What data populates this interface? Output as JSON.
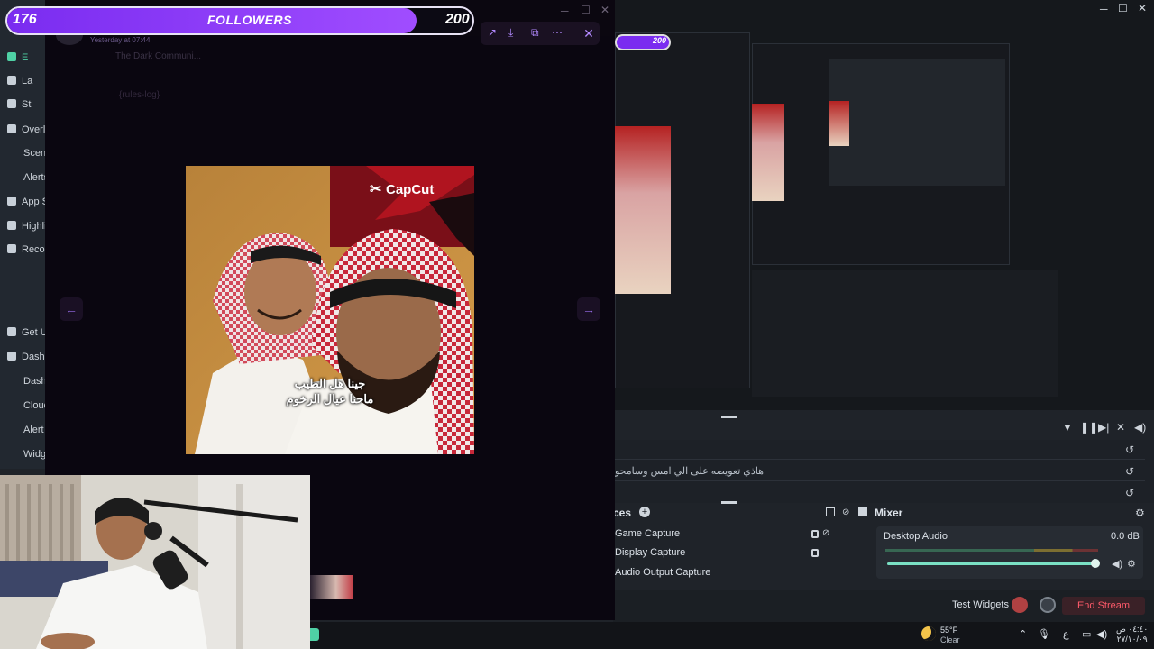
{
  "follower_goal": {
    "label": "FOLLOWERS",
    "current": "176",
    "goal": "200",
    "progress_fraction": 0.88
  },
  "nested_goal": "200",
  "obs_menu": [
    {
      "label": "E",
      "active": true
    },
    {
      "label": "La"
    },
    {
      "label": "St"
    },
    {
      "label": "Overl"
    },
    {
      "label": "Scene"
    },
    {
      "label": "Alerts"
    },
    {
      "label": "App S"
    },
    {
      "label": "Highli"
    },
    {
      "label": "Reco"
    },
    {
      "label": "Get U"
    },
    {
      "label": "Dashb"
    },
    {
      "label": "Dashb"
    },
    {
      "label": "Cloud"
    },
    {
      "label": "Alert"
    },
    {
      "label": "Widg"
    }
  ],
  "viewer": {
    "timestamp": "Yesterday at 07:44",
    "server_name": "The Dark Communi...",
    "channel": "{rules-log}"
  },
  "photo": {
    "watermark": "CapCut",
    "caption_line1": "جينا هل الطيب",
    "caption_line2": "ماحنا عيال الرخوم"
  },
  "chat_row": "هاذي تعويضه على الي امس وسامحو",
  "sources": {
    "title": "ces",
    "items": [
      "Game Capture",
      "Display Capture",
      "Audio Output Capture"
    ]
  },
  "mixer": {
    "title": "Mixer",
    "channel": "Desktop Audio",
    "db": "0.0 dB",
    "fader_level": 0.98
  },
  "bottom": {
    "test_widgets": "Test Widgets",
    "end_stream": "End Stream"
  },
  "taskbar": {
    "temp": "55°F",
    "condition": "Clear",
    "lang": "ع",
    "clock_time": "٠٤:٤٠ ص",
    "clock_date": "٢٧/١٠/٠٩"
  },
  "colors": {
    "accent_purple": "#8b3dff",
    "obs_green": "#4fd1a5",
    "end_stream_red": "#ff5a6a"
  }
}
